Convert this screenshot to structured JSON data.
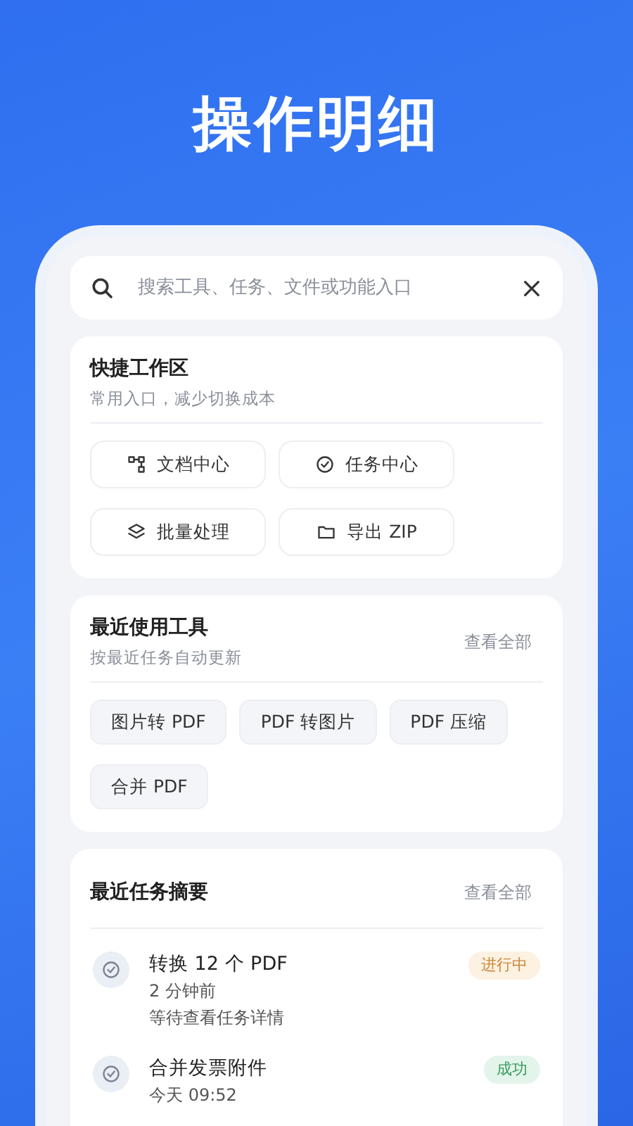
{
  "page_title": "操作明细",
  "search": {
    "placeholder": "搜索工具、任务、文件或功能入口"
  },
  "quick": {
    "title": "快捷工作区",
    "subtitle": "常用入口，减少切换成本",
    "items": [
      {
        "label": "文档中心",
        "kind": "docs"
      },
      {
        "label": "任务中心",
        "kind": "tasks"
      },
      {
        "label": "批量处理",
        "kind": "batch"
      },
      {
        "label": "导出 ZIP",
        "kind": "export"
      }
    ]
  },
  "tools": {
    "title": "最近使用工具",
    "subtitle": "按最近任务自动更新",
    "link": "查看全部",
    "items": [
      "图片转 PDF",
      "PDF 转图片",
      "PDF 压缩",
      "合并 PDF"
    ]
  },
  "tasks": {
    "title": "最近任务摘要",
    "link": "查看全部",
    "items": [
      {
        "name": "转换 12 个 PDF",
        "time": "2 分钟前",
        "note": "等待查看任务详情",
        "status": "进行中",
        "kind": "running"
      },
      {
        "name": "合并发票附件",
        "time": "今天 09:52",
        "status": "成功",
        "kind": "success"
      }
    ]
  }
}
